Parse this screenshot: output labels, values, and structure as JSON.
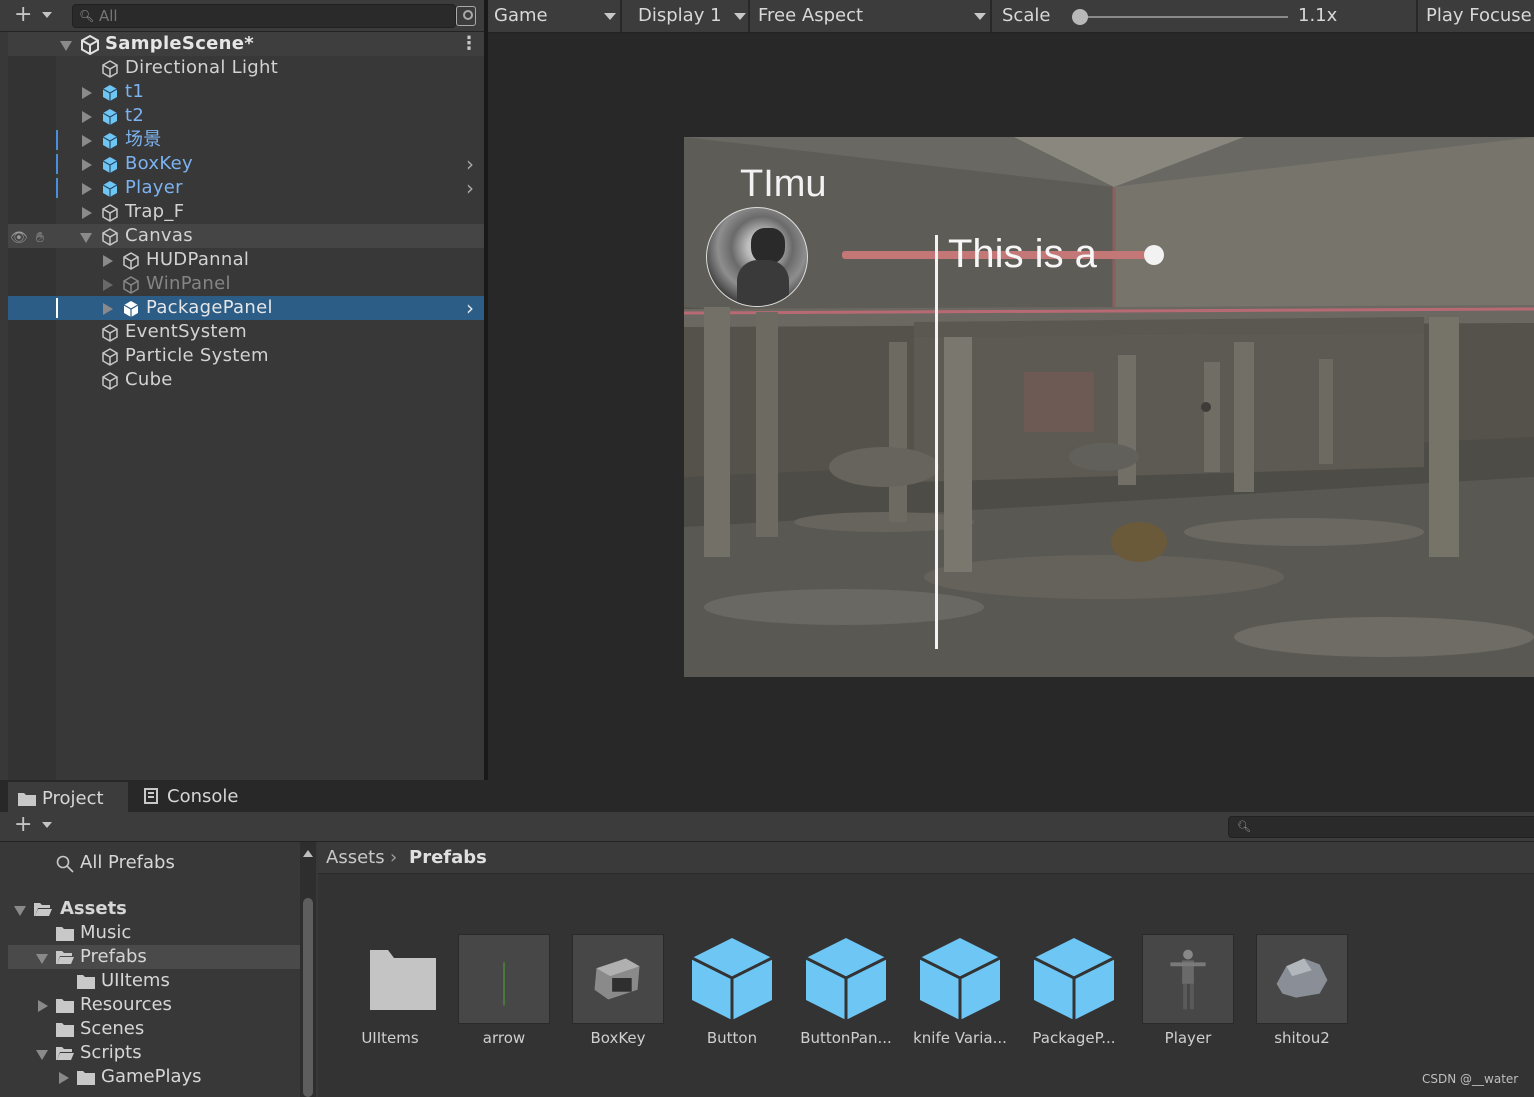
{
  "hierarchy": {
    "search_placeholder": "All",
    "scene": {
      "name": "SampleScene*"
    },
    "items": [
      {
        "label": "Directional Light"
      },
      {
        "label": "t1"
      },
      {
        "label": "t2"
      },
      {
        "label": "场景"
      },
      {
        "label": "BoxKey"
      },
      {
        "label": "Player"
      },
      {
        "label": "Trap_F"
      },
      {
        "label": "Canvas"
      },
      {
        "label": "HUDPannal"
      },
      {
        "label": "WinPanel"
      },
      {
        "label": "PackagePanel"
      },
      {
        "label": "EventSystem"
      },
      {
        "label": "Particle System"
      },
      {
        "label": "Cube"
      }
    ]
  },
  "game_toolbar": {
    "view": "Game",
    "display": "Display 1",
    "aspect": "Free Aspect",
    "scale_label": "Scale",
    "scale_value": "1.1x",
    "play_mode": "Play Focuse"
  },
  "game_view": {
    "hud_name": "TImu",
    "hud_text": "This is a"
  },
  "project": {
    "tabs": [
      {
        "label": "Project"
      },
      {
        "label": "Console"
      }
    ],
    "search_placeholder": "",
    "favorites": [
      {
        "label": "All Prefabs"
      }
    ],
    "folders": [
      {
        "label": "Assets"
      },
      {
        "label": "Music"
      },
      {
        "label": "Prefabs"
      },
      {
        "label": "UIItems"
      },
      {
        "label": "Resources"
      },
      {
        "label": "Scenes"
      },
      {
        "label": "Scripts"
      },
      {
        "label": "GamePlays"
      }
    ],
    "breadcrumb": {
      "root": "Assets",
      "current": "Prefabs"
    },
    "assets": [
      {
        "name": "UIItems"
      },
      {
        "name": "arrow"
      },
      {
        "name": "BoxKey"
      },
      {
        "name": "Button"
      },
      {
        "name": "ButtonPan..."
      },
      {
        "name": "knife Varia..."
      },
      {
        "name": "PackageP..."
      },
      {
        "name": "Player"
      },
      {
        "name": "shitou2"
      }
    ]
  },
  "watermark": "CSDN @__water",
  "colors": {
    "selection": "#2c5d87",
    "prefab_text": "#7cb3f0",
    "prefab_cube": "#6ec6f5",
    "panel": "#383838"
  }
}
